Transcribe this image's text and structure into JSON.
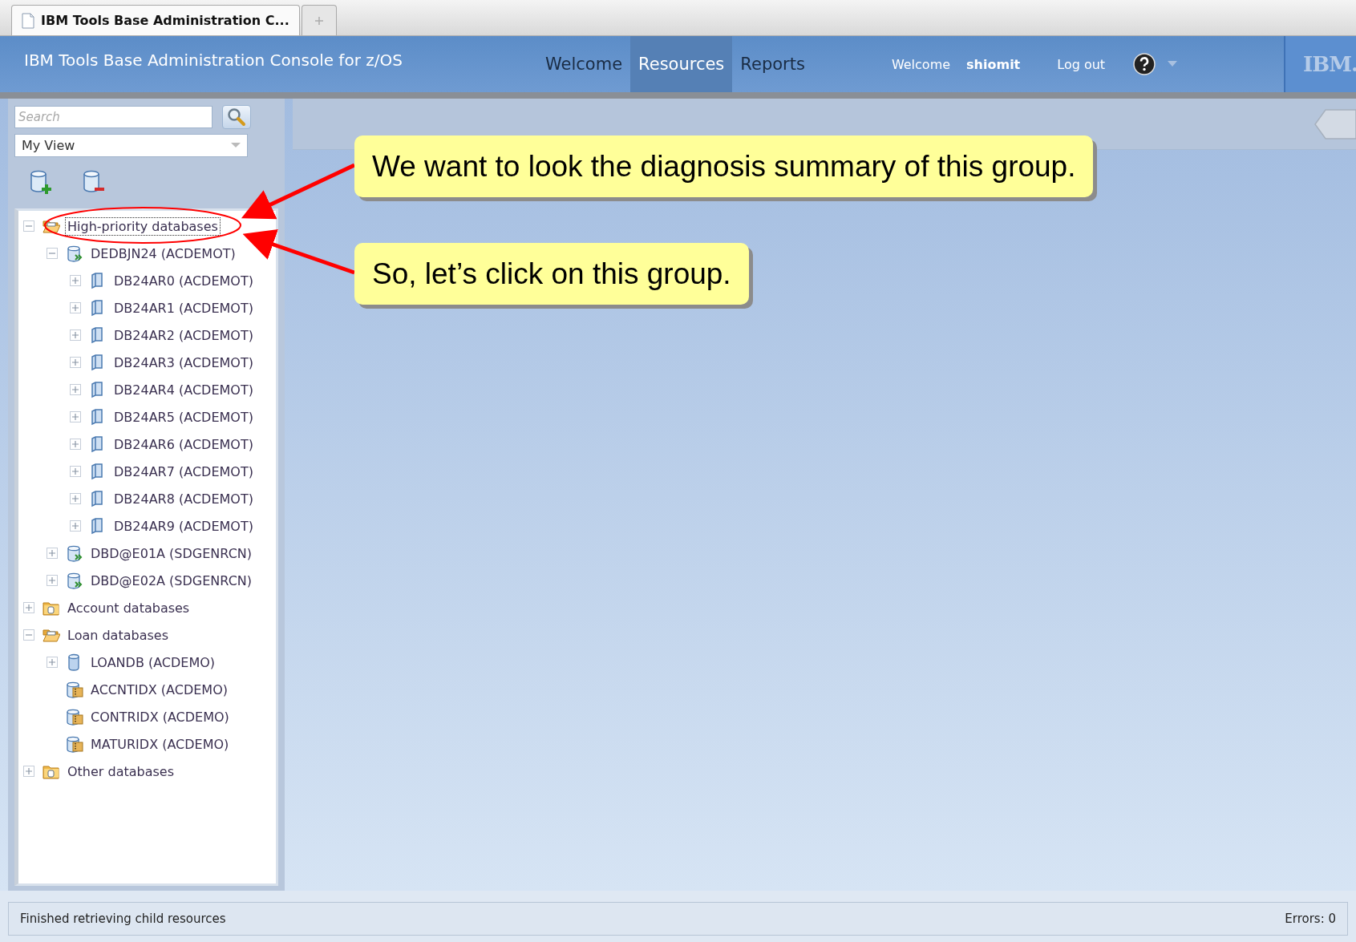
{
  "browser_tabs": [
    {
      "label": "IBM Tools Base Administration C...",
      "selected": true,
      "kind": "page"
    },
    {
      "kind": "new-tab",
      "selected": false
    }
  ],
  "header": {
    "title": "IBM Tools Base Administration Console for z/OS",
    "nav": [
      {
        "label": "Welcome",
        "selected": false
      },
      {
        "label": "Resources",
        "selected": true
      },
      {
        "label": "Reports",
        "selected": false
      }
    ],
    "greeting": "Welcome",
    "user": "shiomit",
    "logout": "Log out",
    "logo": "IBM."
  },
  "sidebar": {
    "search": {
      "placeholder": "Search"
    },
    "view": "My View",
    "tree": [
      {
        "label": "High-priority databases",
        "kind": "folder-open",
        "expanded": true,
        "selected": true,
        "children": [
          {
            "label": "DEDBJN24 (ACDEMOT)",
            "kind": "dbd",
            "expanded": true,
            "selected": false,
            "children": [
              {
                "label": "DB24AR0 (ACDEMOT)",
                "kind": "area",
                "expanded": false,
                "selected": false
              },
              {
                "label": "DB24AR1 (ACDEMOT)",
                "kind": "area",
                "expanded": false,
                "selected": false
              },
              {
                "label": "DB24AR2 (ACDEMOT)",
                "kind": "area",
                "expanded": false,
                "selected": false
              },
              {
                "label": "DB24AR3 (ACDEMOT)",
                "kind": "area",
                "expanded": false,
                "selected": false
              },
              {
                "label": "DB24AR4 (ACDEMOT)",
                "kind": "area",
                "expanded": false,
                "selected": false
              },
              {
                "label": "DB24AR5 (ACDEMOT)",
                "kind": "area",
                "expanded": false,
                "selected": false
              },
              {
                "label": "DB24AR6 (ACDEMOT)",
                "kind": "area",
                "expanded": false,
                "selected": false
              },
              {
                "label": "DB24AR7 (ACDEMOT)",
                "kind": "area",
                "expanded": false,
                "selected": false
              },
              {
                "label": "DB24AR8 (ACDEMOT)",
                "kind": "area",
                "expanded": false,
                "selected": false
              },
              {
                "label": "DB24AR9 (ACDEMOT)",
                "kind": "area",
                "expanded": false,
                "selected": false
              }
            ]
          },
          {
            "label": "DBD@E01A (SDGENRCN)",
            "kind": "dbd",
            "expanded": false,
            "selected": false
          },
          {
            "label": "DBD@E02A (SDGENRCN)",
            "kind": "dbd",
            "expanded": false,
            "selected": false
          }
        ]
      },
      {
        "label": "Account databases",
        "kind": "folder",
        "expanded": false,
        "selected": false
      },
      {
        "label": "Loan databases",
        "kind": "folder-open",
        "expanded": true,
        "selected": false,
        "children": [
          {
            "label": "LOANDB (ACDEMO)",
            "kind": "database",
            "expanded": false,
            "selected": false
          },
          {
            "label": "ACCNTIDX (ACDEMO)",
            "kind": "index",
            "selected": false
          },
          {
            "label": "CONTRIDX (ACDEMO)",
            "kind": "index",
            "selected": false
          },
          {
            "label": "MATURIDX (ACDEMO)",
            "kind": "index",
            "selected": false
          }
        ]
      },
      {
        "label": "Other databases",
        "kind": "folder",
        "expanded": false,
        "selected": false
      }
    ]
  },
  "callouts": [
    "We want to look the diagnosis summary of this group.",
    "So, let’s click on this group."
  ],
  "status_bar": {
    "message": "Finished retrieving child resources",
    "errors": "Errors: 0"
  }
}
